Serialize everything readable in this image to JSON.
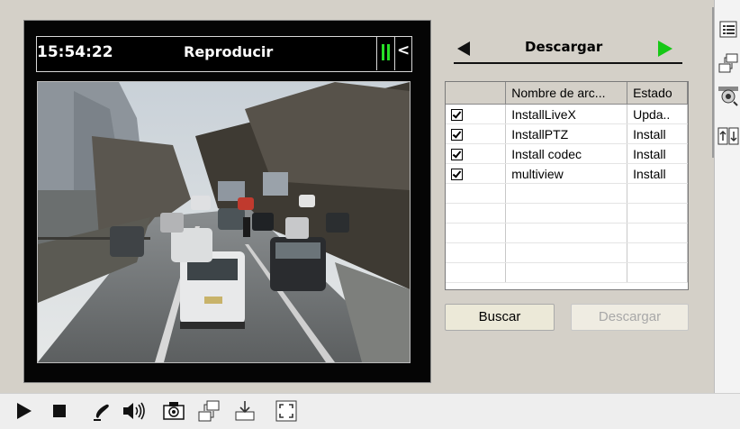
{
  "player": {
    "time": "15:54:22",
    "title": "Reproducir",
    "pause_label": "pause",
    "collapse_label": "<"
  },
  "download": {
    "title": "Descargar",
    "columns": [
      "",
      "Nombre de arc...",
      "Estado"
    ],
    "rows": [
      {
        "checked": true,
        "name": "InstallLiveX",
        "status": "Upda.."
      },
      {
        "checked": true,
        "name": "InstallPTZ",
        "status": "Install"
      },
      {
        "checked": true,
        "name": "Install codec",
        "status": "Install"
      },
      {
        "checked": true,
        "name": "multiview",
        "status": "Install"
      }
    ],
    "search_label": "Buscar",
    "download_label": "Descargar"
  },
  "side_icons": [
    "list-icon",
    "network-icon",
    "ptz-camera-icon",
    "transfer-icon"
  ],
  "toolbar_icons": [
    "play-icon",
    "stop-icon",
    "pen-icon",
    "volume-icon",
    "camera-icon",
    "network-icon",
    "download-icon",
    "fullscreen-icon"
  ],
  "colors": {
    "accent_green": "#16c816",
    "pause_green": "#27e027",
    "panel_black": "#050505",
    "frame_gray": "#d4d0c8"
  }
}
